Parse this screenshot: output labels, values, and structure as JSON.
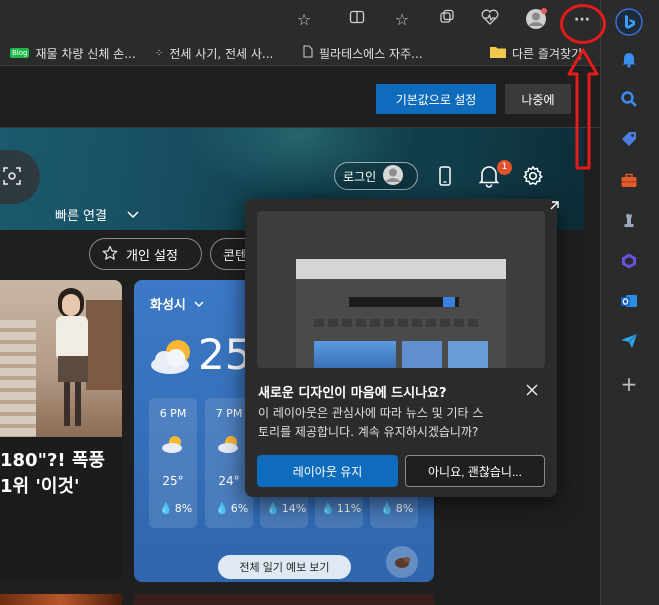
{
  "toolbar": {
    "more_icon_label": "···"
  },
  "bookmarks": [
    {
      "badge": "Blog",
      "label": "재물 차량 신체 손..."
    },
    {
      "label": "전세 사기, 전세 사..."
    },
    {
      "label": "필라테스에스 자주..."
    },
    {
      "label": "다른 즐겨찾기"
    }
  ],
  "infobar": {
    "set_default_label": "기본값으로 설정",
    "later_label": "나중에"
  },
  "header": {
    "quick_links_label": "빠른 연결",
    "login_label": "로그인",
    "notification_count": "1"
  },
  "chips": {
    "personalize_label": "개인 설정",
    "content_label": "콘텐"
  },
  "news": {
    "headline_line1": "180\"?! 폭풍",
    "headline_line2": "1위 '이것'"
  },
  "weather": {
    "location": "화성시",
    "current_temp": "25",
    "forecast_button": "전체 일기 예보 보기",
    "hours": [
      {
        "time": "6 PM",
        "temp": "25°",
        "precip": "8%"
      },
      {
        "time": "7 PM",
        "temp": "24°",
        "precip": "6%"
      },
      {
        "time": "",
        "temp": "",
        "precip": "14%"
      },
      {
        "time": "",
        "temp": "",
        "precip": "11%"
      },
      {
        "time": "",
        "temp": "",
        "precip": "8%"
      }
    ]
  },
  "popup": {
    "title": "새로운 디자인이 마음에 드시나요?",
    "body_line1": "이 레이아웃은 관심사에 따라 뉴스 및 기타 스",
    "body_line2": "토리를 제공합니다. 계속 유지하시겠습니까?",
    "keep_label": "레이아웃 유지",
    "no_label": "아니요, 괜찮습니..."
  },
  "colors": {
    "accent": "#0f6cbd",
    "annotation": "#e41b1b",
    "weather_bg": "#3c79c6",
    "popup_bg": "#2b2b2b"
  }
}
